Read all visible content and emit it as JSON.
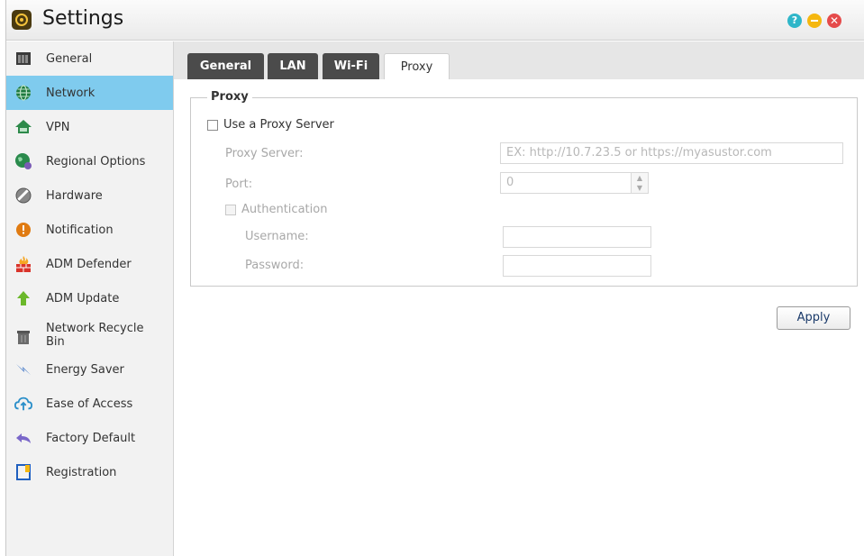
{
  "window": {
    "title": "Settings"
  },
  "controls": {
    "help": "?",
    "close": "✕"
  },
  "sidebar": {
    "items": [
      {
        "label": "General",
        "icon": "server-icon"
      },
      {
        "label": "Network",
        "icon": "globe-icon",
        "active": true
      },
      {
        "label": "VPN",
        "icon": "vpn-house-icon"
      },
      {
        "label": "Regional Options",
        "icon": "regional-globe-icon"
      },
      {
        "label": "Hardware",
        "icon": "hardware-icon"
      },
      {
        "label": "Notification",
        "icon": "alert-icon"
      },
      {
        "label": "ADM Defender",
        "icon": "firewall-icon"
      },
      {
        "label": "ADM Update",
        "icon": "up-arrow-icon"
      },
      {
        "label": "Network Recycle Bin",
        "icon": "trash-icon"
      },
      {
        "label": "Energy Saver",
        "icon": "lightning-icon"
      },
      {
        "label": "Ease of Access",
        "icon": "cloud-upload-icon"
      },
      {
        "label": "Factory Default",
        "icon": "undo-arrow-icon"
      },
      {
        "label": "Registration",
        "icon": "registration-icon"
      }
    ]
  },
  "tabs": [
    {
      "label": "General"
    },
    {
      "label": "LAN"
    },
    {
      "label": "Wi-Fi"
    },
    {
      "label": "Proxy",
      "active": true
    }
  ],
  "proxy": {
    "legend": "Proxy",
    "use_proxy_label": "Use a Proxy Server",
    "use_proxy_checked": false,
    "server_label": "Proxy Server:",
    "server_placeholder": "EX: http://10.7.23.5 or https://myasustor.com",
    "port_label": "Port:",
    "port_value": "0",
    "auth_label": "Authentication",
    "auth_checked": false,
    "username_label": "Username:",
    "username_value": "",
    "password_label": "Password:",
    "password_value": ""
  },
  "actions": {
    "apply_label": "Apply"
  },
  "colors": {
    "accent": "#7fcbee",
    "tab_dark": "#4b4b4b"
  }
}
